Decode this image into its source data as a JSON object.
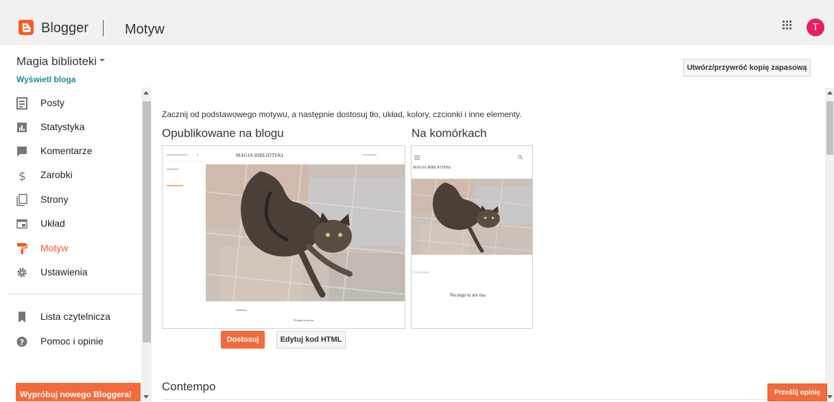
{
  "app": {
    "name": "Blogger",
    "section": "Motyw",
    "avatar_letter": "T",
    "accent": "#ff5722",
    "avatar_color": "#e91e63"
  },
  "sidebar": {
    "blog_name": "Magia biblioteki",
    "view_blog": "Wyświetl bloga",
    "items": [
      {
        "label": "Posty",
        "icon": "posts-icon"
      },
      {
        "label": "Statystyka",
        "icon": "stats-icon"
      },
      {
        "label": "Komentarze",
        "icon": "comments-icon"
      },
      {
        "label": "Zarobki",
        "icon": "dollar-icon"
      },
      {
        "label": "Strony",
        "icon": "pages-icon"
      },
      {
        "label": "Układ",
        "icon": "layout-icon"
      },
      {
        "label": "Motyw",
        "icon": "paint-roller-icon",
        "active": true
      },
      {
        "label": "Ustawienia",
        "icon": "gear-icon"
      }
    ],
    "secondary": [
      {
        "label": "Lista czytelnicza",
        "icon": "bookmark-icon"
      },
      {
        "label": "Pomoc i opinie",
        "icon": "help-icon"
      }
    ],
    "try_new": "Wypróbuj nowego Bloggera!"
  },
  "main": {
    "backup_button": "Utwórz/przywróć kopię zapasową",
    "intro": "Zacznij od podstawowego motywu, a następnie dostosuj tło, układ, kolory, czcionki i inne elementy.",
    "published_heading": "Opublikowane na blogu",
    "mobile_heading": "Na komórkach",
    "preview_blog_title": "MAGIA BIBLIOTEKI",
    "preview_empty": "Niczego tu nie ma.",
    "mobile_label": "POLECANE",
    "customize_button": "Dostosuj",
    "edit_html_button": "Edytuj kod HTML",
    "next_theme": "Contempo"
  },
  "feedback_button": "Prześlij opinię"
}
